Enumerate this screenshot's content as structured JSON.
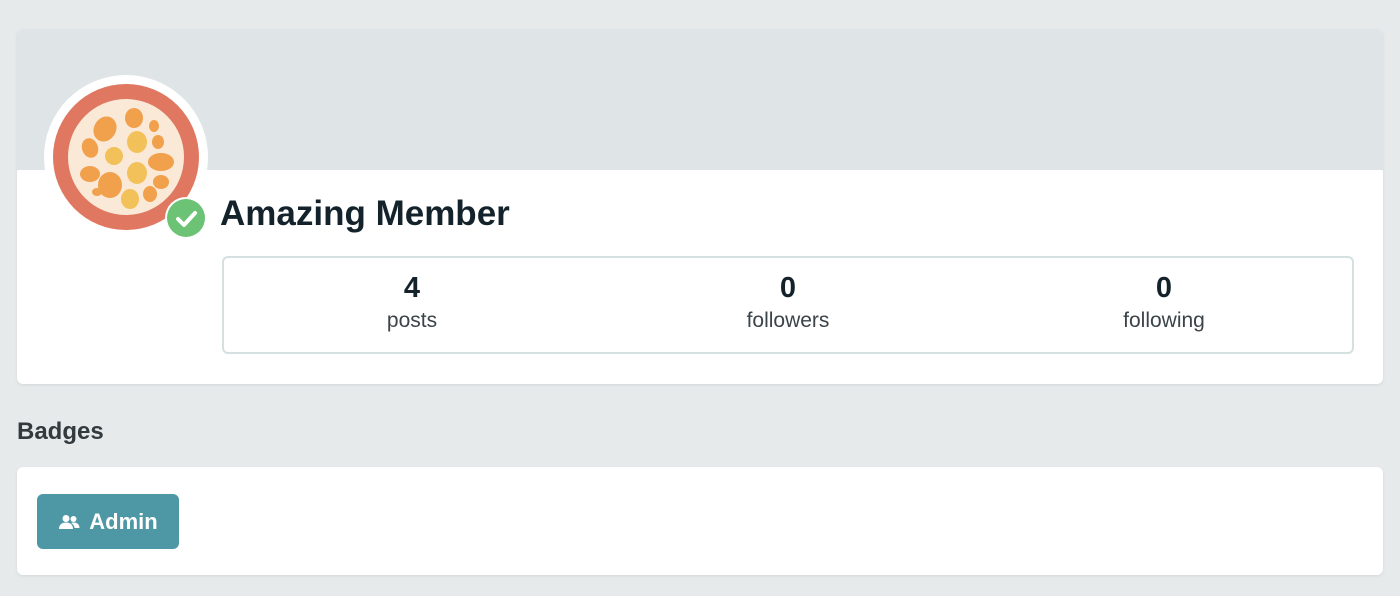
{
  "profile": {
    "display_name": "Amazing Member",
    "avatar_icon": "passion-fruit-avatar",
    "verified_icon": "check-icon",
    "colors": {
      "avatar_ring": "#e07761",
      "avatar_fill": "#fbe9d7",
      "verified": "#6cc375"
    }
  },
  "stats": [
    {
      "value": "4",
      "label": "posts"
    },
    {
      "value": "0",
      "label": "followers"
    },
    {
      "value": "0",
      "label": "following"
    }
  ],
  "badges": {
    "title": "Badges",
    "items": [
      {
        "label": "Admin",
        "icon": "users-icon",
        "color": "#4e97a4"
      }
    ]
  }
}
